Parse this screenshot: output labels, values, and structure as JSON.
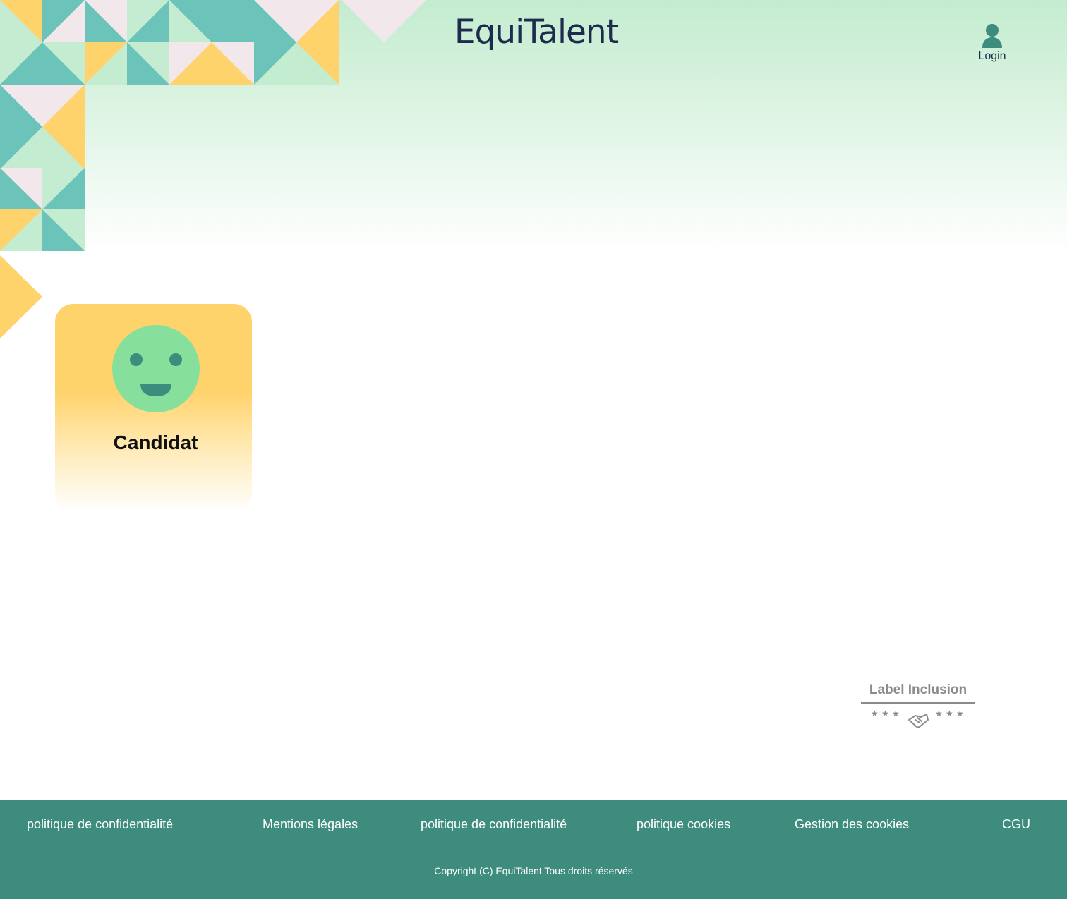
{
  "brand": {
    "logo_text": "EquiTalent"
  },
  "header": {
    "login_label": "Login"
  },
  "card": {
    "label": "Candidat"
  },
  "badge": {
    "title": "Label Inclusion"
  },
  "footer": {
    "links": [
      "politique de confidentialité",
      "Mentions légales",
      "politique de confidentialité",
      "politique cookies",
      "Gestion des cookies",
      "CGU"
    ],
    "copyright": "Copyright (C) EquiTalent Tous droits réservés"
  },
  "colors": {
    "teal": "#6cc3b9",
    "mint": "#c3ecd1",
    "yellow": "#ffd36b",
    "blush": "#f2e8eb",
    "dark_green": "#3d8c7d",
    "navy": "#1f2b4d",
    "face_green": "#86df9b",
    "badge_grey": "#8a8a8a"
  },
  "icons": {
    "login": "user-icon",
    "card": "smiley-face-icon",
    "badge": "handshake-icon"
  }
}
